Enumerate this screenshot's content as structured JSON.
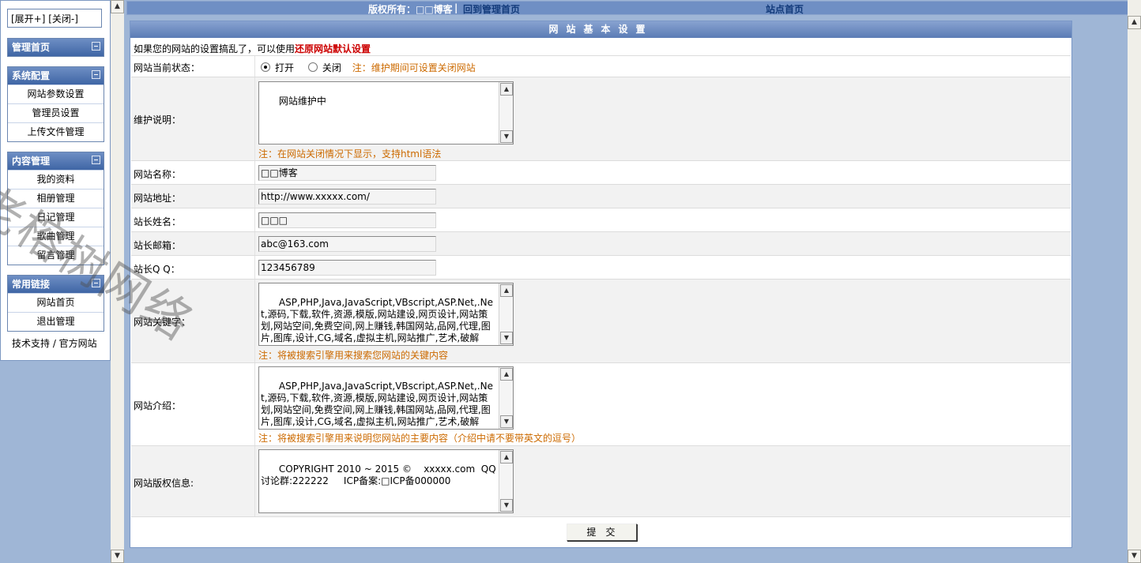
{
  "sidebar": {
    "toggle": "[展开+] [关闭-]",
    "groups": [
      {
        "title": "管理首页",
        "items": []
      },
      {
        "title": "系统配置",
        "items": [
          "网站参数设置",
          "管理员设置",
          "上传文件管理"
        ]
      },
      {
        "title": "内容管理",
        "items": [
          "我的资料",
          "相册管理",
          "日记管理",
          "歌曲管理",
          "留言管理"
        ]
      },
      {
        "title": "常用链接",
        "items": [
          "网站首页",
          "退出管理"
        ]
      }
    ],
    "footer": "技术支持 / 官方网站"
  },
  "topbar": {
    "copyright": "版权所有：□□博客",
    "sep": "|",
    "admin_home": "回到管理首页",
    "site_home": "站点首页"
  },
  "panel": {
    "title": "网站基本设置",
    "intro": "如果您的网站的设置搞乱了，可以使用",
    "restore_link": "还原网站默认设置",
    "status": {
      "label": "网站当前状态：",
      "open": "打开",
      "close": "关闭",
      "selected": "打开",
      "note": "注：维护期间可设置关闭网站"
    },
    "maintenance": {
      "label": "维护说明：",
      "value": "网站维护中",
      "note": "注：在网站关闭情况下显示，支持html语法"
    },
    "site_name": {
      "label": "网站名称：",
      "value": "□□博客"
    },
    "site_url": {
      "label": "网站地址：",
      "value": "http://www.xxxxx.com/"
    },
    "owner_name": {
      "label": "站长姓名：",
      "value": "□□□"
    },
    "owner_email": {
      "label": "站长邮箱：",
      "value": "abc@163.com"
    },
    "owner_qq": {
      "label": "站长Q Q：",
      "value": "123456789"
    },
    "keywords": {
      "label": "网站关键字：",
      "value": "ASP,PHP,Java,JavaScript,VBscript,ASP.Net,.Net,源码,下载,软件,资源,模版,网站建设,网页设计,网站策划,网站空间,免费空间,网上赚钱,韩国网站,品网,代理,图片,图库,设计,CG,域名,虚拟主机,网站推广,艺术,破解",
      "note": "注：将被搜索引擎用来搜索您网站的关键内容"
    },
    "description": {
      "label": "网站介绍：",
      "value": "ASP,PHP,Java,JavaScript,VBscript,ASP.Net,.Net,源码,下载,软件,资源,模版,网站建设,网页设计,网站策划,网站空间,免费空间,网上赚钱,韩国网站,品网,代理,图片,图库,设计,CG,域名,虚拟主机,网站推广,艺术,破解",
      "note": "注：将被搜索引擎用来说明您网站的主要内容（介绍中请不要带英文的逗号）"
    },
    "copyright_info": {
      "label": "网站版权信息:",
      "value": "COPYRIGHT 2010 ~ 2015 ©    xxxxx.com  QQ讨论群:222222     ICP备案:□ICP备000000"
    },
    "submit": "提交"
  },
  "watermark": "老榕树网络",
  "colors": {
    "accent": "#5b7cb5",
    "note": "#cc6a00",
    "restore": "#cc0000",
    "background": "#9fb6d6"
  }
}
